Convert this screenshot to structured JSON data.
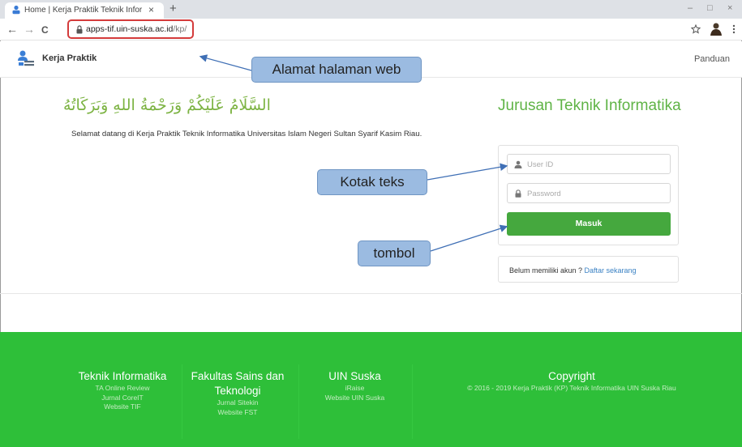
{
  "browser": {
    "tab_title": "Home | Kerja Praktik Teknik Infor",
    "tab_close": "×",
    "new_tab": "+",
    "url_host": "apps-tif.uin-suska.ac.id",
    "url_path": "/kp/",
    "window_controls": [
      "–",
      "□",
      "×"
    ],
    "nav": {
      "back": "←",
      "forward": "→",
      "reload": "C"
    }
  },
  "site": {
    "brand": "Kerja Praktik",
    "nav_right": "Panduan"
  },
  "main": {
    "greeting_arabic": "السَّلَامُ عَلَيْكُمْ وَرَحْمَةُ اللهِ وَبَرَكَاتُهُ",
    "welcome": "Selamat datang di Kerja Praktik Teknik Informatika Universitas Islam Negeri Sultan Syarif Kasim Riau.",
    "dept_title": "Jurusan Teknik Informatika"
  },
  "login": {
    "userid_placeholder": "User ID",
    "password_placeholder": "Password",
    "submit_label": "Masuk",
    "register_text": "Belum memiliki akun ? ",
    "register_link": "Daftar sekarang"
  },
  "annotations": {
    "address": "Alamat halaman web",
    "textbox": "Kotak teks",
    "button": "tombol"
  },
  "footer": {
    "col1": {
      "title": "Teknik Informatika",
      "links": [
        "TA Online Review",
        "Jurnal CoreIT",
        "Website TIF"
      ]
    },
    "col2": {
      "title_line1": "Fakultas Sains dan",
      "title_line2": "Teknologi",
      "links": [
        "Jurnal Sitekin",
        "Website FST"
      ]
    },
    "col3": {
      "title": "UIN Suska",
      "links": [
        "iRaise",
        "Website UIN Suska"
      ]
    },
    "col4": {
      "title": "Copyright",
      "text": "© 2016 - 2019 Kerja Praktik (KP) Teknik Informatika UIN Suska Riau"
    }
  },
  "colors": {
    "footer_bg": "#2ebf39",
    "button_green": "#45a83e",
    "title_green": "#5fb346",
    "callout_blue": "#9bbbe1",
    "highlight_red": "#d43b3b"
  }
}
